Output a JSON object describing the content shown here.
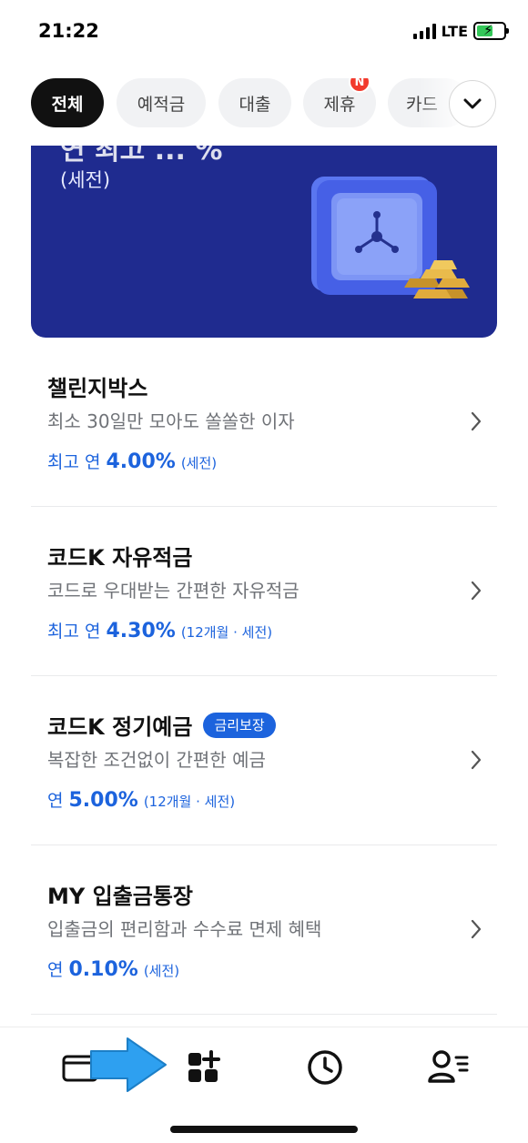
{
  "status_bar": {
    "time": "21:22",
    "network": "LTE",
    "battery_level": 0.6
  },
  "chips": [
    {
      "label": "전체",
      "active": true
    },
    {
      "label": "예적금",
      "active": false
    },
    {
      "label": "대출",
      "active": false
    },
    {
      "label": "제휴",
      "active": false,
      "badge": "N"
    },
    {
      "label": "카드",
      "active": false
    }
  ],
  "banner": {
    "partial_text": "연 최고 ... %",
    "note": "(세전)"
  },
  "products": [
    {
      "title": "챌린지박스",
      "tag": "",
      "desc": "최소 30일만 모아도 쏠쏠한 이자",
      "rate_prefix": "최고 연",
      "rate": "4.00%",
      "rate_cond": "(세전)"
    },
    {
      "title": "코드K 자유적금",
      "tag": "",
      "desc": "코드로 우대받는 간편한 자유적금",
      "rate_prefix": "최고 연",
      "rate": "4.30%",
      "rate_cond": "(12개월 · 세전)"
    },
    {
      "title": "코드K 정기예금",
      "tag": "금리보장",
      "desc": "복잡한 조건없이 간편한 예금",
      "rate_prefix": "연",
      "rate": "5.00%",
      "rate_cond": "(12개월 · 세전)"
    },
    {
      "title": "MY 입출금통장",
      "tag": "",
      "desc": "입출금의 편리함과 수수료 면제 혜택",
      "rate_prefix": "연",
      "rate": "0.10%",
      "rate_cond": "(세전)"
    }
  ],
  "bottom_nav": [
    {
      "icon": "wallet-icon"
    },
    {
      "icon": "products-add-icon"
    },
    {
      "icon": "history-clock-icon"
    },
    {
      "icon": "profile-menu-icon"
    }
  ],
  "colors": {
    "accent": "#1c63dd",
    "banner": "#1f2b8f",
    "badge": "#f23a2d",
    "hint_arrow": "#2ea0f0"
  }
}
